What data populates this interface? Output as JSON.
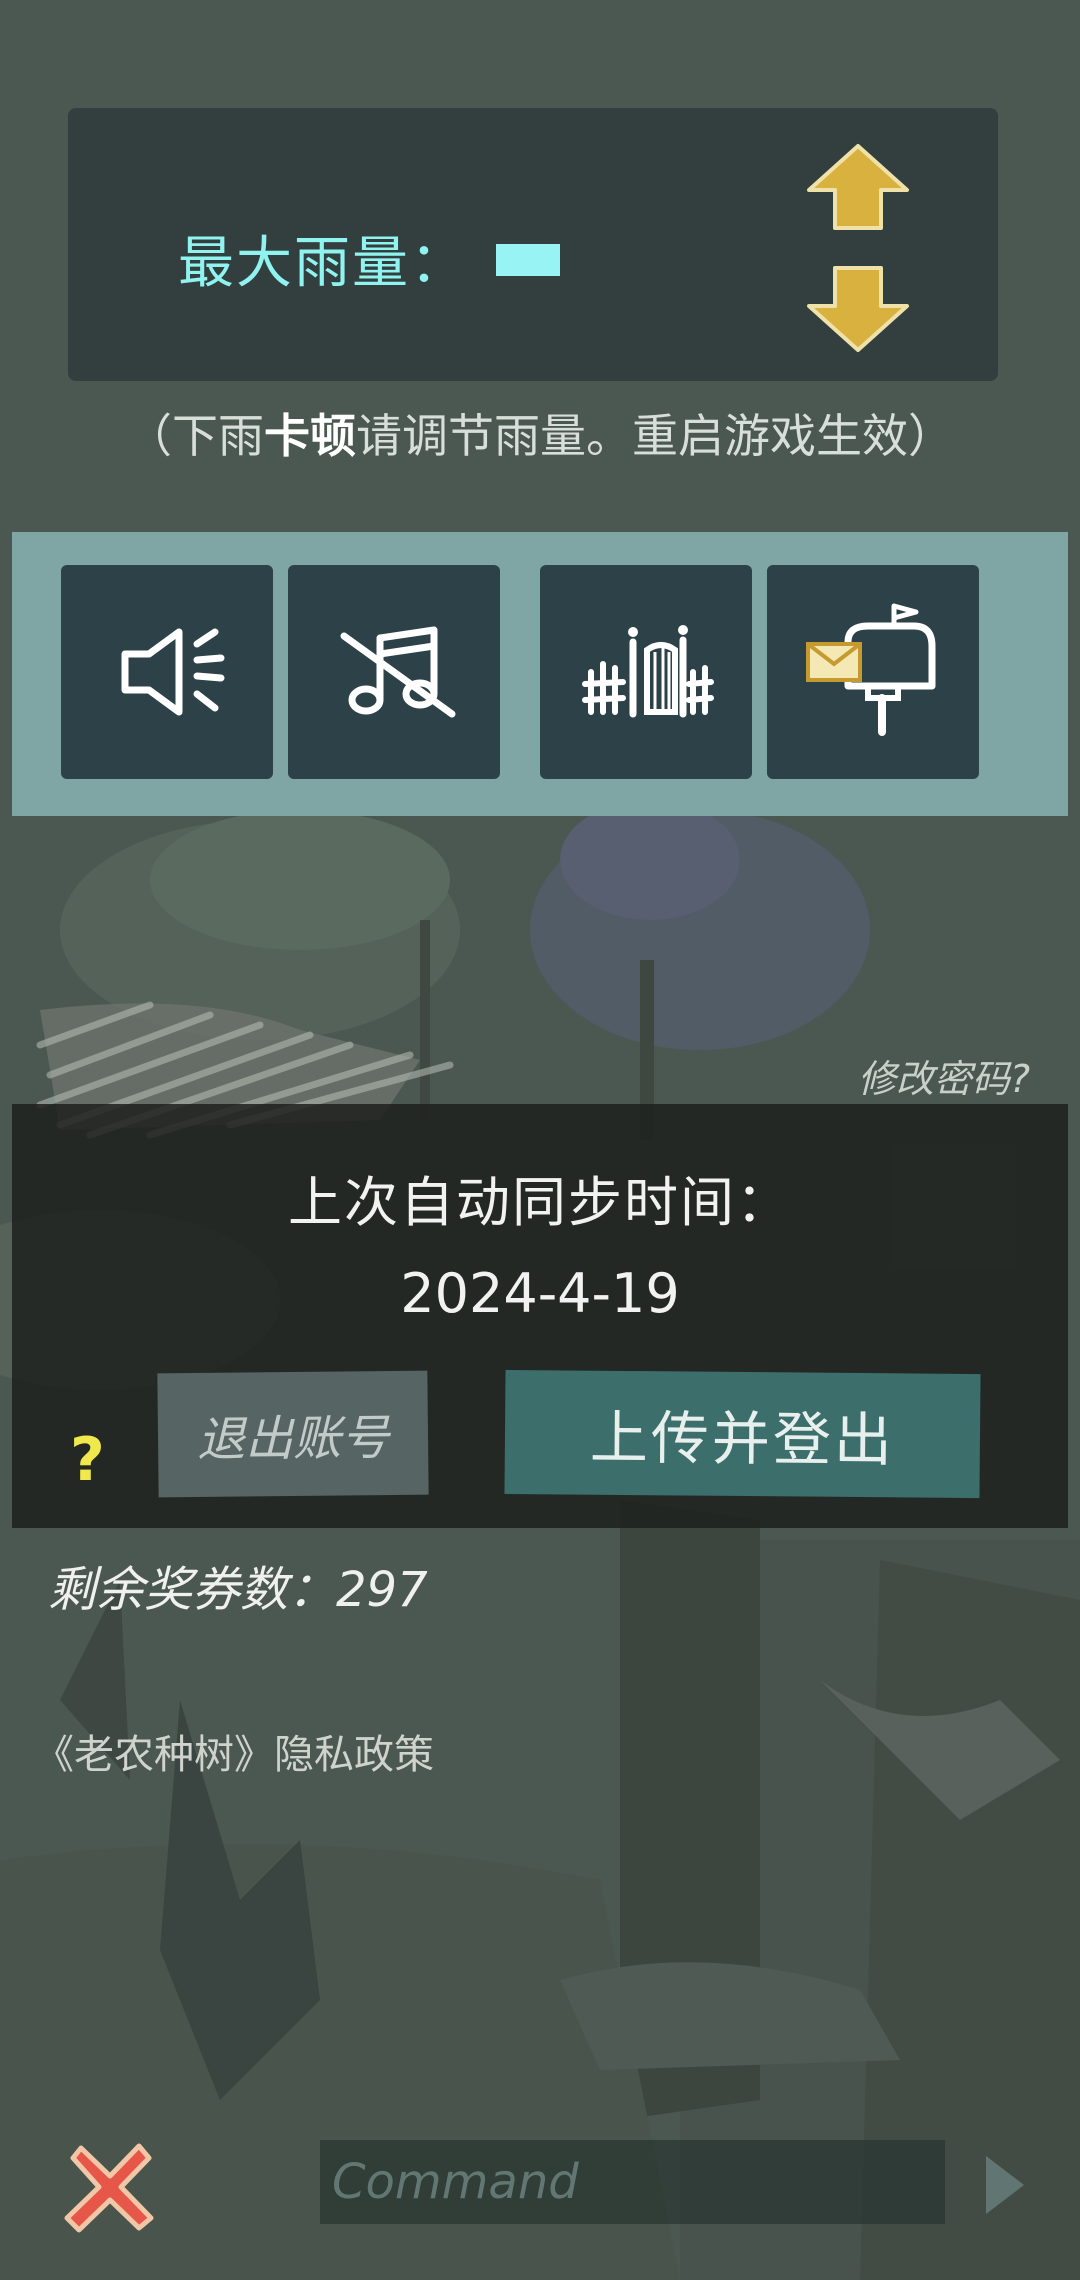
{
  "rain": {
    "label": "最大雨量：",
    "hint_prefix": "（下雨",
    "hint_bold": "卡顿",
    "hint_suffix": "请调节雨量。重启游戏生效）"
  },
  "settings": {
    "tiles": [
      "sound-icon",
      "music-muted-icon",
      "fence-gate-icon",
      "mailbox-icon"
    ]
  },
  "account": {
    "change_password": "修改密码?",
    "sync_label": "上次自动同步时间：",
    "sync_date": "2024-4-19",
    "logout_label": "退出账号",
    "upload_label": "上传并登出",
    "help": "?"
  },
  "voucher_text": "剩余奖券数：297",
  "privacy_text": "《老农种树》隐私政策",
  "command": {
    "placeholder": "Command"
  },
  "colors": {
    "accent_cyan": "#8ff3ef",
    "arrow_gold": "#d8b13f",
    "close_red": "#e6574a",
    "upload_teal": "#3c6e6c"
  }
}
